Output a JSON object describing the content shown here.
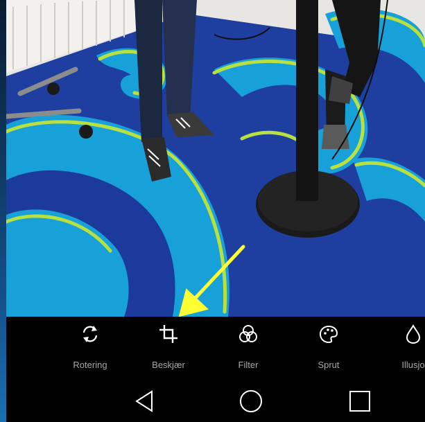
{
  "toolbar": {
    "items": [
      {
        "label": "Rotering",
        "icon": "rotate-icon"
      },
      {
        "label": "Beskjær",
        "icon": "crop-icon"
      },
      {
        "label": "Filter",
        "icon": "filter-icon"
      },
      {
        "label": "Sprut",
        "icon": "palette-icon"
      },
      {
        "label": "Illusjo",
        "icon": "droplet-icon"
      }
    ]
  },
  "navbar": {
    "items": [
      {
        "icon": "back-icon"
      },
      {
        "icon": "home-icon"
      },
      {
        "icon": "recents-icon"
      }
    ]
  },
  "colors": {
    "carpet_blue": "#1f3fa0",
    "carpet_cyan": "#18a0d8",
    "carpet_lime": "#b8e040",
    "arrow": "#ffff33",
    "toolbar_bg": "#000000",
    "icon_color": "#ffffff",
    "label_color": "#a9a9a9"
  }
}
